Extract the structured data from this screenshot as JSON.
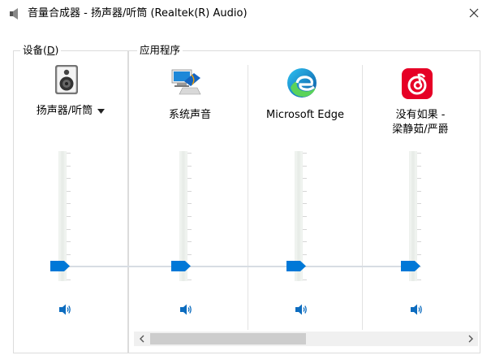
{
  "window": {
    "title": "音量合成器 - 扬声器/听筒 (Realtek(R) Audio)",
    "close_icon": "close-icon",
    "title_icon": "speaker-icon"
  },
  "device_group": {
    "legend_main": "设备(",
    "legend_key": "D",
    "legend_end": ")",
    "device": {
      "label": "扬声器/听筒",
      "icon": "speaker-device-icon",
      "dropdown_icon": "triangle-down-icon",
      "volume_level": 0.0,
      "muted": false
    }
  },
  "apps_group": {
    "legend": "应用程序",
    "apps": [
      {
        "label": "系统声音",
        "icon": "system-sounds-icon",
        "volume_level": 0.0
      },
      {
        "label": "Microsoft Edge",
        "icon": "edge-icon",
        "volume_level": 0.0
      },
      {
        "label_line1": "没有如果 -",
        "label_line2": "梁静茹/严爵",
        "icon": "netease-music-icon",
        "volume_level": 0.0
      }
    ]
  },
  "scrollbar": {
    "left_arrow_icon": "chevron-left-icon",
    "right_arrow_icon": "chevron-right-icon"
  },
  "colors": {
    "accent": "#0078d7",
    "edge_blue": "#0c59a4",
    "edge_green": "#5bd35a",
    "netease_red": "#e60026"
  }
}
